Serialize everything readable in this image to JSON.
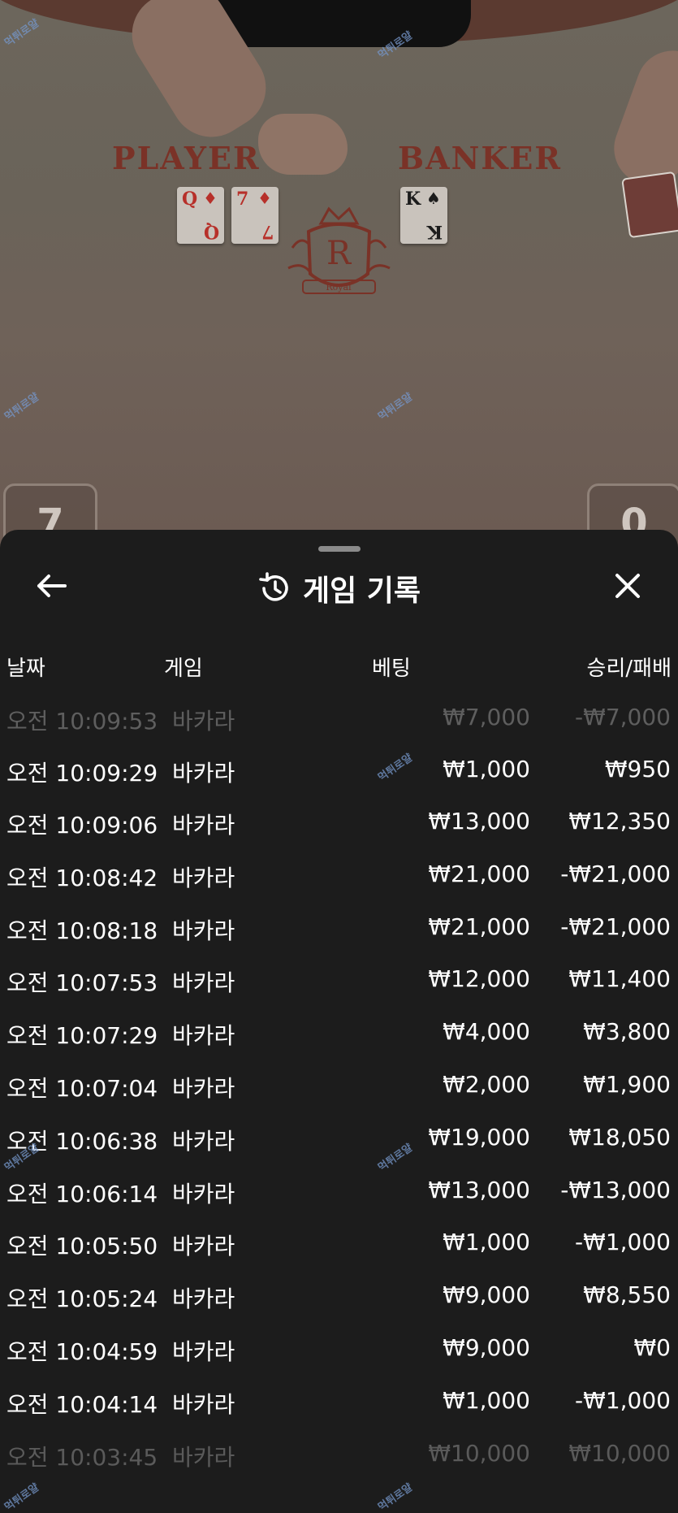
{
  "table": {
    "player_label": "PLAYER",
    "banker_label": "BANKER",
    "emblem_letter": "R",
    "emblem_text": "Royal",
    "player_cards": [
      {
        "rank": "Q",
        "suit": "♦"
      },
      {
        "rank": "7",
        "suit": "♦"
      }
    ],
    "banker_cards": [
      {
        "rank": "K",
        "suit": "♠"
      }
    ],
    "player_score": "7",
    "banker_score": "0",
    "watermark": "먹튀로얄"
  },
  "history": {
    "title": "게임 기록",
    "icons": {
      "back": "arrow-left-icon",
      "title": "history-icon",
      "close": "close-icon"
    },
    "columns": {
      "date": "날짜",
      "game": "게임",
      "bet": "베팅",
      "result": "승리/패배"
    },
    "rows": [
      {
        "date": "오전 10:09:53",
        "game": "바카라",
        "bet": "₩7,000",
        "result": "-₩7,000"
      },
      {
        "date": "오전 10:09:29",
        "game": "바카라",
        "bet": "₩1,000",
        "result": "₩950"
      },
      {
        "date": "오전 10:09:06",
        "game": "바카라",
        "bet": "₩13,000",
        "result": "₩12,350"
      },
      {
        "date": "오전 10:08:42",
        "game": "바카라",
        "bet": "₩21,000",
        "result": "-₩21,000"
      },
      {
        "date": "오전 10:08:18",
        "game": "바카라",
        "bet": "₩21,000",
        "result": "-₩21,000"
      },
      {
        "date": "오전 10:07:53",
        "game": "바카라",
        "bet": "₩12,000",
        "result": "₩11,400"
      },
      {
        "date": "오전 10:07:29",
        "game": "바카라",
        "bet": "₩4,000",
        "result": "₩3,800"
      },
      {
        "date": "오전 10:07:04",
        "game": "바카라",
        "bet": "₩2,000",
        "result": "₩1,900"
      },
      {
        "date": "오전 10:06:38",
        "game": "바카라",
        "bet": "₩19,000",
        "result": "₩18,050"
      },
      {
        "date": "오전 10:06:14",
        "game": "바카라",
        "bet": "₩13,000",
        "result": "-₩13,000"
      },
      {
        "date": "오전 10:05:50",
        "game": "바카라",
        "bet": "₩1,000",
        "result": "-₩1,000"
      },
      {
        "date": "오전 10:05:24",
        "game": "바카라",
        "bet": "₩9,000",
        "result": "₩8,550"
      },
      {
        "date": "오전 10:04:59",
        "game": "바카라",
        "bet": "₩9,000",
        "result": "₩0"
      },
      {
        "date": "오전 10:04:14",
        "game": "바카라",
        "bet": "₩1,000",
        "result": "-₩1,000"
      },
      {
        "date": "오전 10:03:45",
        "game": "바카라",
        "bet": "₩10,000",
        "result": "₩10,000"
      }
    ]
  }
}
